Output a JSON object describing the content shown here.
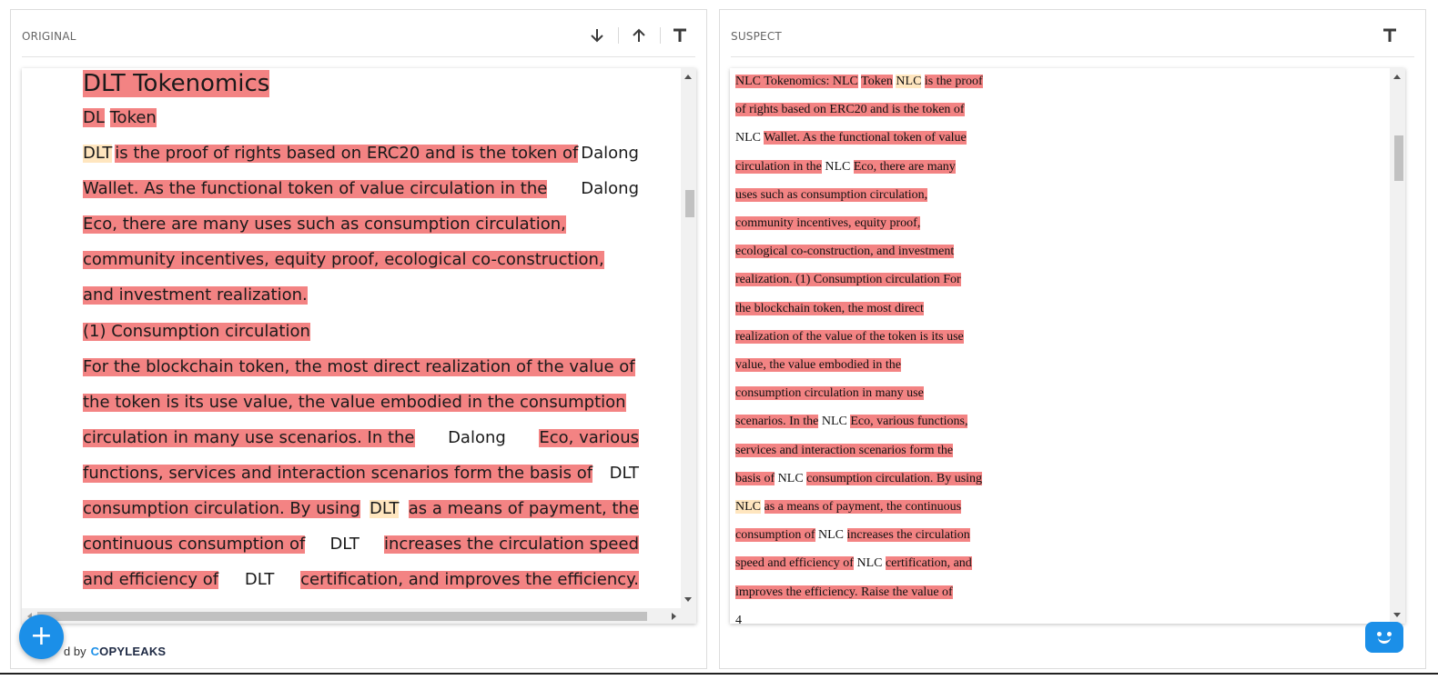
{
  "original_panel": {
    "title": "ORIGINAL",
    "tools": [
      "arrow-down-icon",
      "arrow-up-icon",
      "text-size-icon"
    ],
    "doc": {
      "title": [
        {
          "t": "DLT Tokenomics",
          "h": "red"
        }
      ],
      "subtitle": [
        {
          "t": "DL",
          "h": "red"
        },
        {
          "t": " ",
          "h": ""
        },
        {
          "t": "Token",
          "h": "red"
        }
      ],
      "lines": [
        [
          {
            "t": "DLT",
            "h": "tan"
          },
          {
            "t": "is the proof of rights based on ERC20 and is the token of",
            "h": "red"
          },
          {
            "t": "Dalong",
            "h": ""
          }
        ],
        [
          {
            "t": "Wallet. As the functional token of value circulation in the",
            "h": "red"
          },
          {
            "t": "Dalong",
            "h": ""
          }
        ],
        [
          {
            "t": "Eco, there are many uses such as consumption circulation,",
            "h": "red"
          }
        ],
        [
          {
            "t": "community incentives, equity proof, ecological co-construction,",
            "h": "red"
          }
        ],
        [
          {
            "t": "and investment realization.",
            "h": "red"
          }
        ],
        [
          {
            "t": "(1) Consumption circulation",
            "h": "red"
          }
        ],
        [
          {
            "t": "For the blockchain token, the most direct realization of the value of",
            "h": "red"
          }
        ],
        [
          {
            "t": "the token is its use value, the value embodied in the consumption",
            "h": "red"
          }
        ],
        [
          {
            "t": "circulation in many use scenarios. In the",
            "h": "red"
          },
          {
            "t": "Dalong",
            "h": ""
          },
          {
            "t": "Eco, various",
            "h": "red"
          }
        ],
        [
          {
            "t": "functions, services and interaction scenarios form the basis of",
            "h": "red"
          },
          {
            "t": "DLT",
            "h": ""
          }
        ],
        [
          {
            "t": "consumption circulation. By using",
            "h": "red"
          },
          {
            "t": "DLT",
            "h": "tan"
          },
          {
            "t": "as a means of payment, the",
            "h": "red"
          }
        ],
        [
          {
            "t": "continuous consumption of",
            "h": "red"
          },
          {
            "t": "DLT",
            "h": ""
          },
          {
            "t": "increases the circulation speed",
            "h": "red"
          }
        ],
        [
          {
            "t": "and efficiency of",
            "h": "red"
          },
          {
            "t": "DLT",
            "h": ""
          },
          {
            "t": "certification, and improves the efficiency.",
            "h": "red"
          }
        ]
      ]
    }
  },
  "suspect_panel": {
    "title": "SUSPECT",
    "tools": [
      "text-size-icon"
    ],
    "lines": [
      [
        {
          "t": "NLC Tokenomics: NLC",
          "h": "red"
        },
        {
          "t": " ",
          "h": ""
        },
        {
          "t": "Token",
          "h": "red"
        },
        {
          "t": " ",
          "h": ""
        },
        {
          "t": "NLC",
          "h": "tan"
        },
        {
          "t": " ",
          "h": ""
        },
        {
          "t": "is the proof",
          "h": "red"
        }
      ],
      [
        {
          "t": "of rights based on ERC20 and is the token of",
          "h": "red"
        }
      ],
      [
        {
          "t": "NLC ",
          "h": ""
        },
        {
          "t": "Wallet. As the functional token of value",
          "h": "red"
        }
      ],
      [
        {
          "t": "circulation in the",
          "h": "red"
        },
        {
          "t": " NLC ",
          "h": ""
        },
        {
          "t": "Eco, there are many",
          "h": "red"
        }
      ],
      [
        {
          "t": "uses such as consumption circulation,",
          "h": "red"
        }
      ],
      [
        {
          "t": "community incentives, equity proof,",
          "h": "red"
        }
      ],
      [
        {
          "t": "ecological co-construction, and investment",
          "h": "red"
        }
      ],
      [
        {
          "t": "realization. (1) Consumption circulation For",
          "h": "red"
        }
      ],
      [
        {
          "t": "the blockchain token, the most direct",
          "h": "red"
        }
      ],
      [
        {
          "t": "realization of the value of the token is its use",
          "h": "red"
        }
      ],
      [
        {
          "t": "value, the value embodied in the",
          "h": "red"
        }
      ],
      [
        {
          "t": "consumption circulation in many use",
          "h": "red"
        }
      ],
      [
        {
          "t": "scenarios. In the",
          "h": "red"
        },
        {
          "t": " NLC ",
          "h": ""
        },
        {
          "t": "Eco, various functions,",
          "h": "red"
        }
      ],
      [
        {
          "t": "services and interaction scenarios form the",
          "h": "red"
        }
      ],
      [
        {
          "t": "basis of",
          "h": "red"
        },
        {
          "t": " NLC ",
          "h": ""
        },
        {
          "t": "consumption circulation. By using",
          "h": "red"
        }
      ],
      [
        {
          "t": "NLC",
          "h": "tan"
        },
        {
          "t": " ",
          "h": ""
        },
        {
          "t": "as a means of payment, the continuous",
          "h": "red"
        }
      ],
      [
        {
          "t": "consumption of",
          "h": "red"
        },
        {
          "t": " NLC ",
          "h": ""
        },
        {
          "t": "increases the circulation",
          "h": "red"
        }
      ],
      [
        {
          "t": "speed and efficiency of",
          "h": "red"
        },
        {
          "t": " NLC ",
          "h": ""
        },
        {
          "t": "certification, and",
          "h": "red"
        }
      ],
      [
        {
          "t": "improves the efficiency. Raise the value of",
          "h": "red"
        }
      ],
      [
        {
          "t": "4",
          "h": ""
        }
      ]
    ]
  },
  "footer": {
    "powered_prefix": "d by",
    "brand_c": "C",
    "brand_rest": "OPYLEAKS"
  },
  "fab_label": "+",
  "colors": {
    "match_red": "#f38383",
    "minor_tan": "#ffe6bf",
    "accent": "#1b8fe8"
  }
}
